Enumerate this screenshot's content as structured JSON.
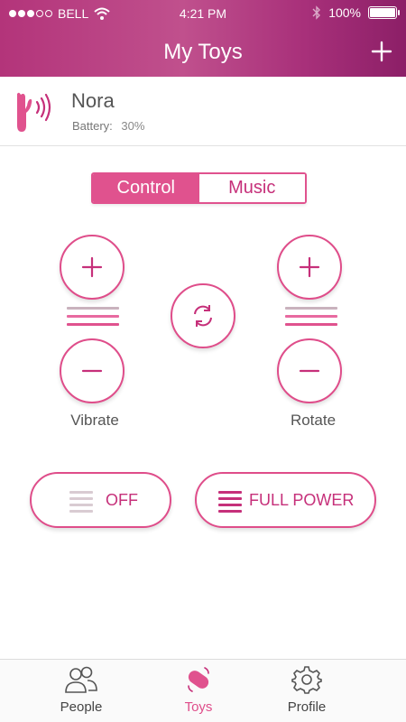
{
  "status_bar": {
    "carrier": "BELL",
    "time": "4:21 PM",
    "battery_text": "100%",
    "battery_level": 1.0,
    "signal_bars_filled": 3,
    "signal_bars_total": 5
  },
  "header": {
    "title": "My Toys",
    "add_icon": "plus-icon"
  },
  "device": {
    "name": "Nora",
    "battery_label": "Battery:",
    "battery_value": "30%",
    "icon": "toy-device-icon"
  },
  "segmented": {
    "options": [
      "Control",
      "Music"
    ],
    "selected": "Control"
  },
  "controls": {
    "vibrate": {
      "label": "Vibrate",
      "level_bars": 3
    },
    "rotate": {
      "label": "Rotate",
      "level_bars": 3
    },
    "rotate_direction_icon": "refresh-icon"
  },
  "actions": {
    "off_label": "OFF",
    "full_power_label": "FULL POWER"
  },
  "tabs": [
    {
      "label": "People",
      "icon": "people-icon",
      "active": false
    },
    {
      "label": "Toys",
      "icon": "toy-icon",
      "active": true
    },
    {
      "label": "Profile",
      "icon": "gear-icon",
      "active": false
    }
  ],
  "colors": {
    "accent": "#df4d8a",
    "accent_dark": "#c6307a",
    "header_gradient": [
      "#b3347a",
      "#8c1f67"
    ]
  }
}
